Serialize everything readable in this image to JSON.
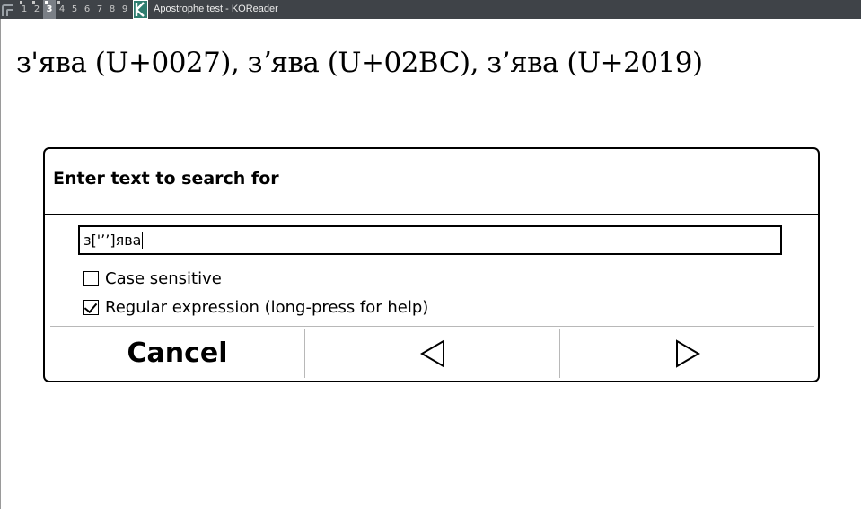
{
  "titlebar": {
    "workspaces": [
      "1",
      "2",
      "3",
      "4",
      "5",
      "6",
      "7",
      "8",
      "9"
    ],
    "active_workspace": "3",
    "window_title": "Apostrophe test - KOReader"
  },
  "document": {
    "line": "з'ява (U+0027), зʼява (U+02BC), з’ява (U+2019)"
  },
  "search_dialog": {
    "title": "Enter text to search for",
    "input_value": "з['ʼ’]ява",
    "options": {
      "case_sensitive": {
        "label": "Case sensitive",
        "checked": false
      },
      "regex": {
        "label": "Regular expression (long-press for help)",
        "checked": true
      }
    },
    "buttons": {
      "cancel": "Cancel",
      "previous_icon": "triangle-left-icon",
      "next_icon": "triangle-right-icon"
    }
  }
}
